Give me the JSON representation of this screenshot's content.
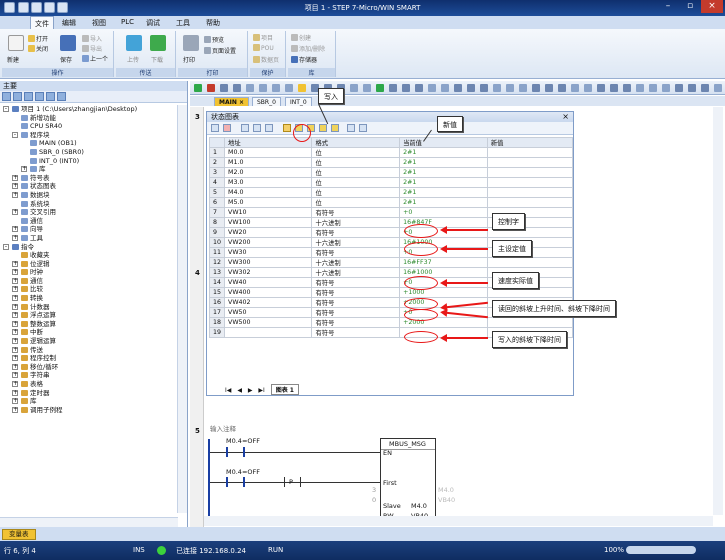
{
  "window": {
    "title": "项目 1 - STEP 7-Micro/WIN SMART"
  },
  "menu": [
    "文件",
    "编辑",
    "视图",
    "PLC",
    "调试",
    "工具",
    "帮助"
  ],
  "ribbon": {
    "groups": [
      {
        "label": "操作",
        "buttons": [
          "新建",
          "打开",
          "关闭",
          "保存",
          "导入",
          "导出",
          "上一个"
        ]
      },
      {
        "label": "传送",
        "buttons": [
          "上传",
          "下载"
        ]
      },
      {
        "label": "打印",
        "buttons": [
          "打印",
          "预览",
          "页面设置"
        ]
      },
      {
        "label": "保护",
        "buttons": [
          "项目",
          "POU",
          "数据页"
        ]
      },
      {
        "label": "库",
        "buttons": [
          "创建",
          "添加/删除",
          "存储器"
        ]
      }
    ]
  },
  "left_panel": {
    "title": "主要",
    "tree": [
      {
        "text": "项目 1 (C:\\Users\\zhangjian\\Desktop)",
        "level": 0,
        "exp": "-"
      },
      {
        "text": "新增功能",
        "level": 1
      },
      {
        "text": "CPU SR40",
        "level": 1
      },
      {
        "text": "程序块",
        "level": 1,
        "exp": "-"
      },
      {
        "text": "MAIN (OB1)",
        "level": 2
      },
      {
        "text": "SBR_0 (SBR0)",
        "level": 2
      },
      {
        "text": "INT_0 (INT0)",
        "level": 2
      },
      {
        "text": "库",
        "level": 2,
        "exp": "+"
      },
      {
        "text": "符号表",
        "level": 1,
        "exp": "+"
      },
      {
        "text": "状态图表",
        "level": 1,
        "exp": "+"
      },
      {
        "text": "数据块",
        "level": 1,
        "exp": "+"
      },
      {
        "text": "系统块",
        "level": 1
      },
      {
        "text": "交叉引用",
        "level": 1,
        "exp": "+"
      },
      {
        "text": "通信",
        "level": 1
      },
      {
        "text": "向导",
        "level": 1,
        "exp": "+"
      },
      {
        "text": "工具",
        "level": 1,
        "exp": "+"
      },
      {
        "text": "指令",
        "level": 0,
        "exp": "-"
      },
      {
        "text": "收藏夹",
        "level": 1
      },
      {
        "text": "位逻辑",
        "level": 1,
        "exp": "+"
      },
      {
        "text": "时钟",
        "level": 1,
        "exp": "+"
      },
      {
        "text": "通信",
        "level": 1,
        "exp": "+"
      },
      {
        "text": "比较",
        "level": 1,
        "exp": "+"
      },
      {
        "text": "转换",
        "level": 1,
        "exp": "+"
      },
      {
        "text": "计数器",
        "level": 1,
        "exp": "+"
      },
      {
        "text": "浮点运算",
        "level": 1,
        "exp": "+"
      },
      {
        "text": "整数运算",
        "level": 1,
        "exp": "+"
      },
      {
        "text": "中断",
        "level": 1,
        "exp": "+"
      },
      {
        "text": "逻辑运算",
        "level": 1,
        "exp": "+"
      },
      {
        "text": "传送",
        "level": 1,
        "exp": "+"
      },
      {
        "text": "程序控制",
        "level": 1,
        "exp": "+"
      },
      {
        "text": "移位/循环",
        "level": 1,
        "exp": "+"
      },
      {
        "text": "字符串",
        "level": 1,
        "exp": "+"
      },
      {
        "text": "表格",
        "level": 1,
        "exp": "+"
      },
      {
        "text": "定时器",
        "level": 1,
        "exp": "+"
      },
      {
        "text": "库",
        "level": 1,
        "exp": "+"
      },
      {
        "text": "调用子例程",
        "level": 1,
        "exp": "+"
      }
    ]
  },
  "editor": {
    "tabs": [
      "MAIN",
      "SBR_0",
      "INT_0"
    ],
    "gutter": [
      "3",
      "4",
      "5"
    ]
  },
  "status_chart": {
    "title": "状态图表",
    "columns": [
      "",
      "地址",
      "格式",
      "当前值",
      "新值"
    ],
    "rows": [
      [
        "1",
        "M0.0",
        "位",
        "2#1",
        ""
      ],
      [
        "2",
        "M1.0",
        "位",
        "2#1",
        ""
      ],
      [
        "3",
        "M2.0",
        "位",
        "2#1",
        ""
      ],
      [
        "4",
        "M3.0",
        "位",
        "2#1",
        ""
      ],
      [
        "5",
        "M4.0",
        "位",
        "2#1",
        ""
      ],
      [
        "6",
        "M5.0",
        "位",
        "2#1",
        ""
      ],
      [
        "7",
        "VW10",
        "有符号",
        "+0",
        ""
      ],
      [
        "8",
        "VW100",
        "十六进制",
        "16#847F",
        ""
      ],
      [
        "9",
        "VW20",
        "有符号",
        "+0",
        ""
      ],
      [
        "10",
        "VW200",
        "十六进制",
        "16#1000",
        ""
      ],
      [
        "11",
        "VW30",
        "有符号",
        "+0",
        ""
      ],
      [
        "12",
        "VW300",
        "十六进制",
        "16#FF37",
        ""
      ],
      [
        "13",
        "VW302",
        "十六进制",
        "16#1000",
        ""
      ],
      [
        "14",
        "VW40",
        "有符号",
        "+0",
        ""
      ],
      [
        "15",
        "VW400",
        "有符号",
        "+1000",
        ""
      ],
      [
        "16",
        "VW402",
        "有符号",
        "+2000",
        ""
      ],
      [
        "17",
        "VW50",
        "有符号",
        "+0",
        ""
      ],
      [
        "18",
        "VW500",
        "有符号",
        "+2000",
        ""
      ],
      [
        "19",
        "",
        "有符号",
        "",
        ""
      ]
    ],
    "sheet_tab": "图表 1",
    "nav": [
      "I◀",
      "◀",
      "▶",
      "▶I"
    ]
  },
  "annotations": {
    "write_in": "写入",
    "new_value": "新值",
    "control_word": "控制字",
    "main_setpoint": "主设定值",
    "actual_speed": "速度实际值",
    "ramp_readback": "读回的斜坡上升时间、斜坡下降时间",
    "ramp_write": "写入的斜坡下降时间"
  },
  "ladder": {
    "comment": "输入注释",
    "contact1": "M0.4=OFF",
    "contact2": "M0.4=OFF",
    "p_contact": "P",
    "box_title": "MBUS_MSG",
    "pins": [
      "EN",
      "First",
      "Slave",
      "RW"
    ],
    "pin_vals_left": [
      "3",
      "0"
    ],
    "pin_vals_right": [
      "M4.0",
      "VB40"
    ],
    "pin_vals_right_dim": [
      "M4.0",
      "VB40"
    ]
  },
  "statusbar": {
    "tab": "变量表",
    "position": "行 6, 列 4",
    "ins": "INS",
    "connection": "已连接 192.168.0.24",
    "mode": "RUN",
    "zoom": "100%"
  }
}
